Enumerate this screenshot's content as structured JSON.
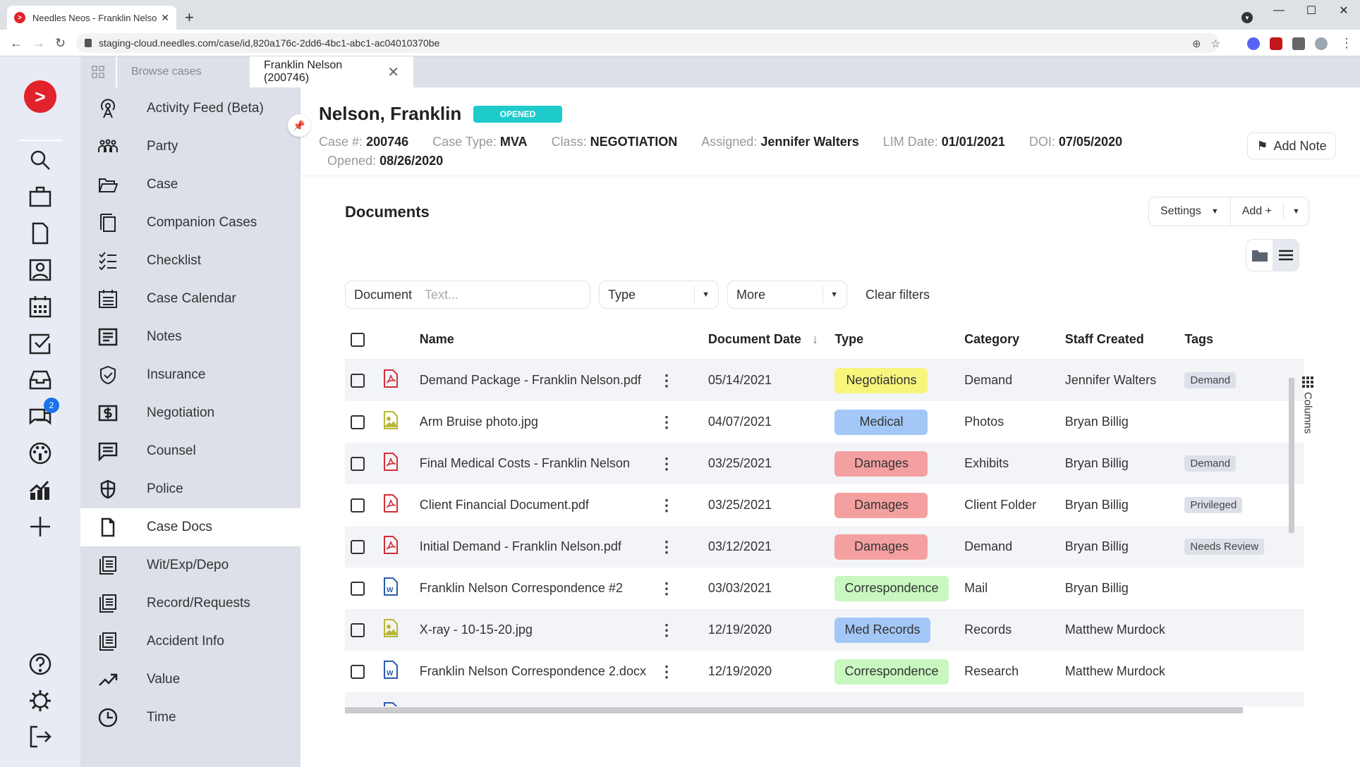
{
  "browser": {
    "tab_title": "Needles Neos - Franklin Nelson (",
    "url": "staging-cloud.needles.com/case/id,820a176c-2dd6-4bc1-abc1-ac04010370be",
    "new_tab": "+",
    "close": "✕",
    "minimize": "—",
    "maximize": "☐",
    "window_close": "✕"
  },
  "app_tabs": [
    {
      "label": "Browse cases",
      "active": false
    },
    {
      "label": "Franklin Nelson (200746)",
      "active": true
    }
  ],
  "rail": {
    "icons": [
      "search-icon",
      "briefcase-icon",
      "document-icon",
      "contact-icon",
      "calendar-icon",
      "checkbox-icon",
      "inbox-icon",
      "chat-icon",
      "dashboard-icon",
      "chart-icon",
      "plus-icon"
    ],
    "chat_badge": "2",
    "bottom_icons": [
      "help-icon",
      "settings-icon",
      "logout-icon"
    ]
  },
  "menu": {
    "items": [
      {
        "label": "Activity Feed (Beta)",
        "icon": "broadcast-icon"
      },
      {
        "label": "Party",
        "icon": "people-icon"
      },
      {
        "label": "Case",
        "icon": "folder-open-icon"
      },
      {
        "label": "Companion Cases",
        "icon": "copy-icon"
      },
      {
        "label": "Checklist",
        "icon": "checklist-icon"
      },
      {
        "label": "Case Calendar",
        "icon": "calendar-list-icon"
      },
      {
        "label": "Notes",
        "icon": "notes-icon"
      },
      {
        "label": "Insurance",
        "icon": "shield-check-icon"
      },
      {
        "label": "Negotiation",
        "icon": "dollar-icon"
      },
      {
        "label": "Counsel",
        "icon": "message-icon"
      },
      {
        "label": "Police",
        "icon": "badge-shield-icon"
      },
      {
        "label": "Case Docs",
        "icon": "document-icon",
        "active": true
      },
      {
        "label": "Wit/Exp/Depo",
        "icon": "stack-doc-icon"
      },
      {
        "label": "Record/Requests",
        "icon": "stack-doc-icon"
      },
      {
        "label": "Accident Info",
        "icon": "stack-doc-icon"
      },
      {
        "label": "Value",
        "icon": "trend-icon"
      },
      {
        "label": "Time",
        "icon": "clock-icon"
      }
    ]
  },
  "case": {
    "name": "Nelson, Franklin",
    "status": "OPENED",
    "fields": [
      {
        "label": "Case #:",
        "value": "200746"
      },
      {
        "label": "Case Type:",
        "value": "MVA"
      },
      {
        "label": "Class:",
        "value": "NEGOTIATION"
      },
      {
        "label": "Assigned:",
        "value": "Jennifer Walters"
      },
      {
        "label": "LIM Date:",
        "value": "01/01/2021"
      },
      {
        "label": "DOI:",
        "value": "07/05/2020"
      },
      {
        "label": "Opened:",
        "value": "08/26/2020"
      }
    ],
    "add_note": "Add Note"
  },
  "documents": {
    "title": "Documents",
    "settings": "Settings",
    "add": "Add +",
    "filter": {
      "document_label": "Document",
      "document_placeholder": "Text...",
      "type": "Type",
      "more": "More",
      "clear": "Clear filters"
    },
    "columns": [
      "Name",
      "Document Date",
      "Type",
      "Category",
      "Staff Created",
      "Tags"
    ],
    "columns_panel": "Columns",
    "sort_indicator": "↓",
    "rows": [
      {
        "icon": "pdf",
        "name": "Demand Package - Franklin Nelson.pdf",
        "date": "05/14/2021",
        "type": "Negotiations",
        "type_color": "#f7f57c",
        "category": "Demand",
        "staff": "Jennifer Walters",
        "tag": "Demand"
      },
      {
        "icon": "image",
        "name": "Arm Bruise photo.jpg",
        "date": "04/07/2021",
        "type": "Medical",
        "type_color": "#a3c8f7",
        "category": "Photos",
        "staff": "Bryan Billig",
        "tag": ""
      },
      {
        "icon": "pdf",
        "name": "Final Medical Costs - Franklin Nelson",
        "date": "03/25/2021",
        "type": "Damages",
        "type_color": "#f4a0a0",
        "category": "Exhibits",
        "staff": "Bryan Billig",
        "tag": "Demand"
      },
      {
        "icon": "pdf",
        "name": "Client Financial Document.pdf",
        "date": "03/25/2021",
        "type": "Damages",
        "type_color": "#f4a0a0",
        "category": "Client Folder",
        "staff": "Bryan Billig",
        "tag": "Privileged"
      },
      {
        "icon": "pdf",
        "name": "Initial Demand - Franklin Nelson.pdf",
        "date": "03/12/2021",
        "type": "Damages",
        "type_color": "#f4a0a0",
        "category": "Demand",
        "staff": "Bryan Billig",
        "tag": "Needs Review"
      },
      {
        "icon": "word",
        "name": "Franklin Nelson Correspondence #2",
        "date": "03/03/2021",
        "type": "Correspondence",
        "type_color": "#c8f7c0",
        "category": "Mail",
        "staff": "Bryan Billig",
        "tag": ""
      },
      {
        "icon": "image",
        "name": "X-ray - 10-15-20.jpg",
        "date": "12/19/2020",
        "type": "Med Records",
        "type_color": "#a3c8f7",
        "category": "Records",
        "staff": "Matthew Murdock",
        "tag": ""
      },
      {
        "icon": "word",
        "name": "Franklin Nelson Correspondence 2.docx",
        "date": "12/19/2020",
        "type": "Correspondence",
        "type_color": "#c8f7c0",
        "category": "Research",
        "staff": "Matthew Murdock",
        "tag": ""
      }
    ]
  },
  "colors": {
    "brand": "#e2222b",
    "status": "#1ecbcb",
    "badge": "#1a73e8"
  }
}
